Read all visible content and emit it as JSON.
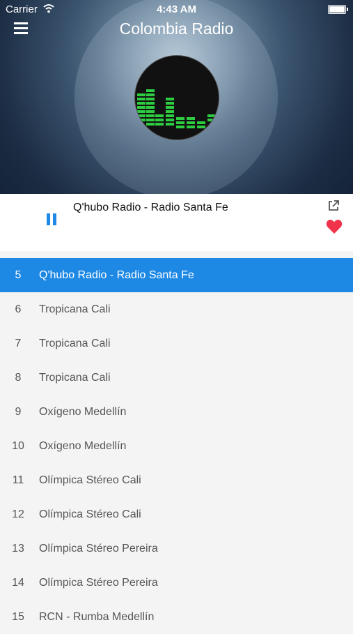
{
  "status": {
    "carrier": "Carrier",
    "time": "4:43 AM"
  },
  "header": {
    "title": "Colombia Radio"
  },
  "player": {
    "now_playing": "Q'hubo Radio - Radio Santa Fe",
    "state": "playing"
  },
  "colors": {
    "accent": "#1e88e5",
    "favorite": "#f0334a",
    "equalizer": "#2ecc40"
  },
  "stations": [
    {
      "num": "5",
      "name": "Q'hubo Radio - Radio Santa Fe",
      "active": true
    },
    {
      "num": "6",
      "name": "Tropicana Cali"
    },
    {
      "num": "7",
      "name": "Tropicana Cali"
    },
    {
      "num": "8",
      "name": "Tropicana Cali"
    },
    {
      "num": "9",
      "name": "Oxígeno Medellín"
    },
    {
      "num": "10",
      "name": "Oxígeno Medellín"
    },
    {
      "num": "11",
      "name": "Olímpica Stéreo Cali"
    },
    {
      "num": "12",
      "name": "Olímpica Stéreo Cali"
    },
    {
      "num": "13",
      "name": "Olímpica Stéreo Pereira"
    },
    {
      "num": "14",
      "name": "Olímpica Stéreo Pereira"
    },
    {
      "num": "15",
      "name": "RCN - Rumba Medellín"
    }
  ]
}
